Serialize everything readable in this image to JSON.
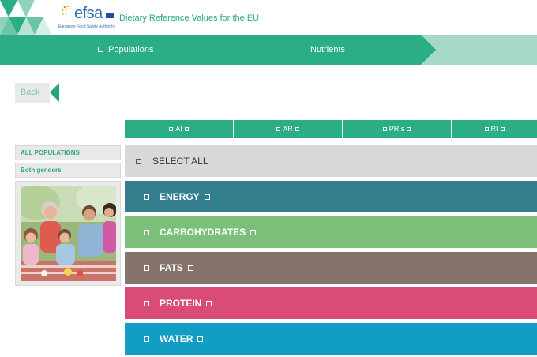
{
  "header": {
    "logo_word": "efsa",
    "logo_subtitle": "European Food Safety Authority",
    "site_title": "Dietary Reference Values for the EU"
  },
  "nav": {
    "items": [
      {
        "label": "Populations",
        "icon": "checkbox-icon"
      },
      {
        "label": "Nutrients"
      }
    ]
  },
  "back_label": "Back",
  "tabs": [
    {
      "label": "AI"
    },
    {
      "label": "AR"
    },
    {
      "label": "PRIs"
    },
    {
      "label": "RI"
    }
  ],
  "sidebar": {
    "population": "ALL POPULATIONS",
    "gender": "Both genders"
  },
  "nutrients": {
    "select_all": "SELECT ALL",
    "items": [
      {
        "label": "ENERGY",
        "color": "#337f8e"
      },
      {
        "label": "CARBOHYDRATES",
        "color": "#7cbf7a"
      },
      {
        "label": "FATS",
        "color": "#86736b"
      },
      {
        "label": "PROTEIN",
        "color": "#d94c78"
      },
      {
        "label": "WATER",
        "color": "#129ec4"
      }
    ]
  },
  "colors": {
    "brand_green": "#2bae86",
    "brand_blue": "#2a6fb3",
    "nav_light": "#a5d9c6"
  }
}
